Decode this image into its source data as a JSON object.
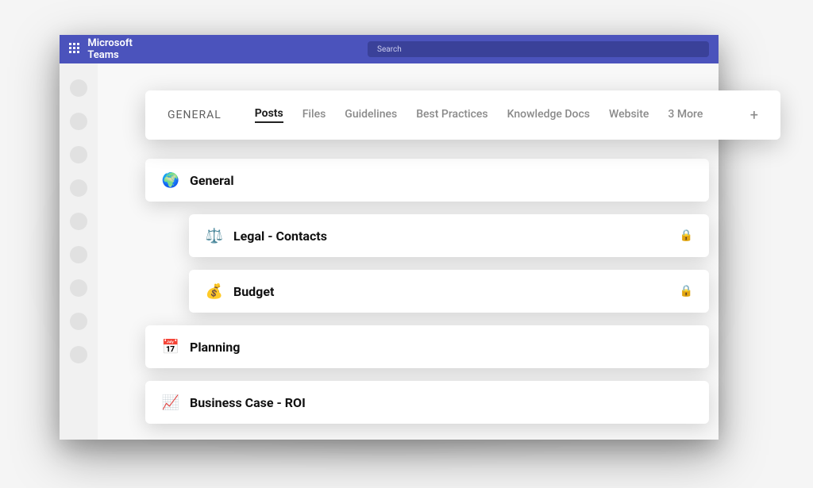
{
  "app": {
    "title": "Microsoft Teams",
    "search_placeholder": "Search"
  },
  "channel": {
    "name": "GENERAL"
  },
  "tabs": {
    "posts": "Posts",
    "files": "Files",
    "guidelines": "Guidelines",
    "best_practices": "Best Practices",
    "knowledge_docs": "Knowledge Docs",
    "website": "Website",
    "more": "3 More",
    "add": "+"
  },
  "items": {
    "general": {
      "icon": "🌍",
      "label": "General"
    },
    "legal": {
      "icon": "⚖️",
      "label": "Legal -  Contacts"
    },
    "budget": {
      "icon": "💰",
      "label": "Budget"
    },
    "planning": {
      "icon": "📅",
      "label": "Planning"
    },
    "roi": {
      "icon": "📈",
      "label": "Business Case  - ROI"
    }
  }
}
